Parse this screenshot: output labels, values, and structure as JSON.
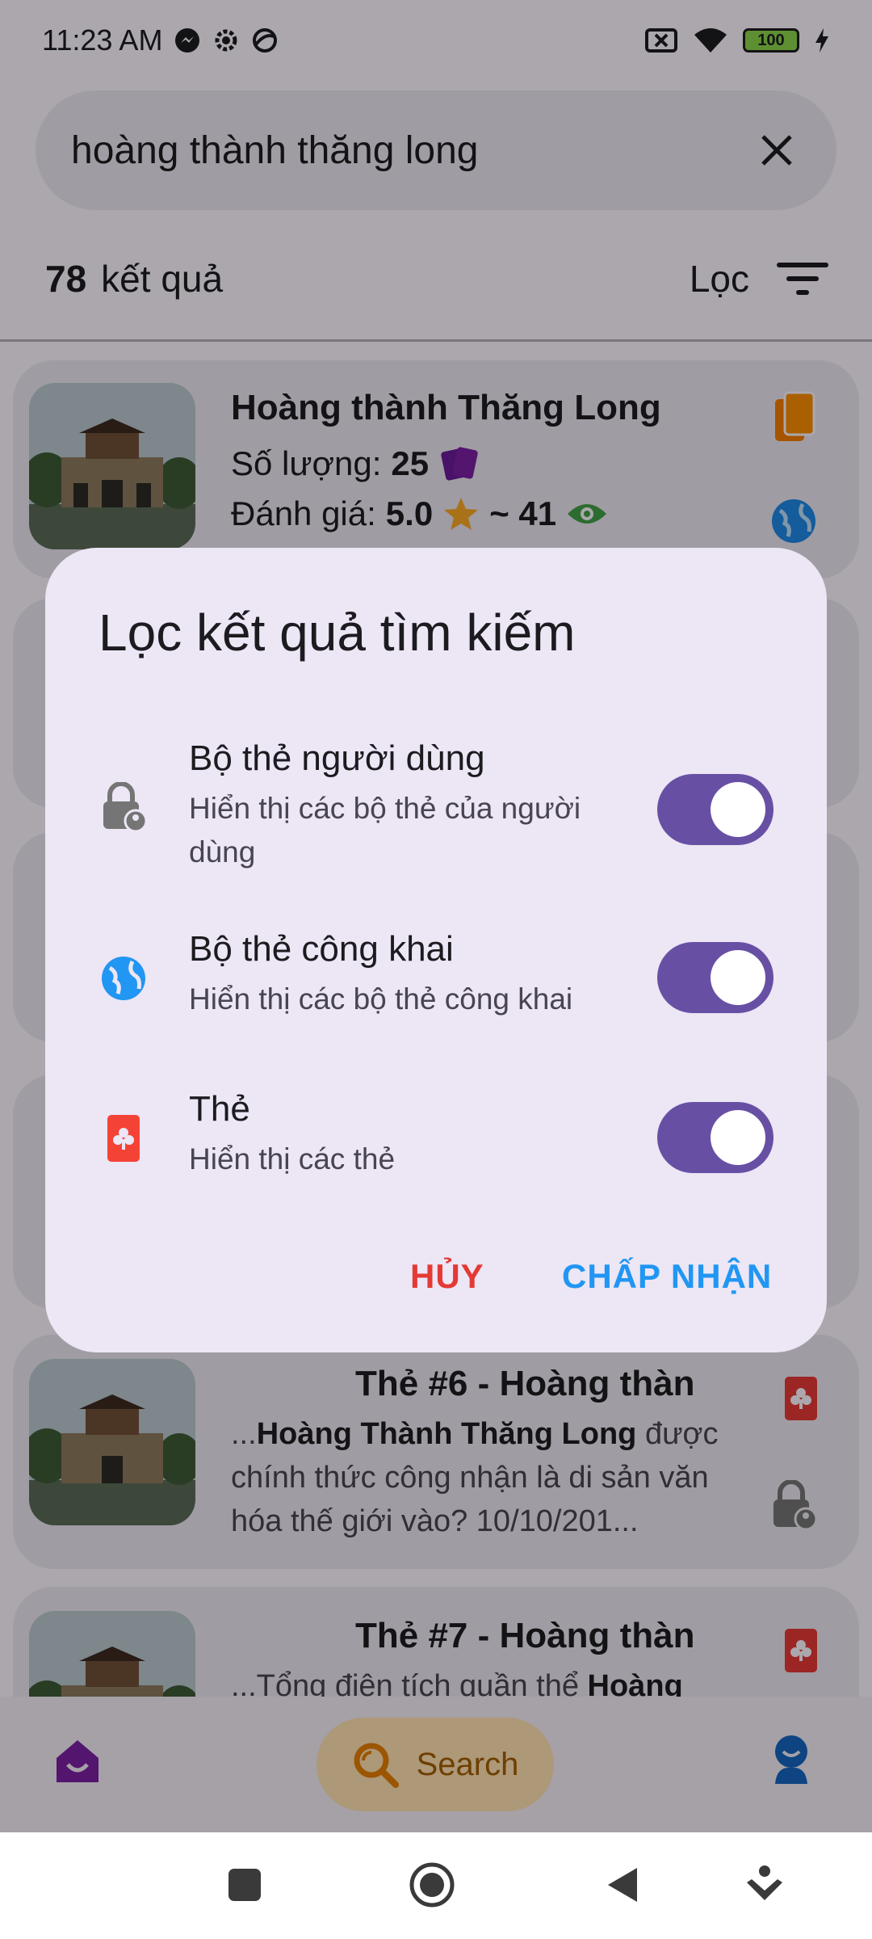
{
  "status_bar": {
    "time": "11:23 AM",
    "battery": "100"
  },
  "search": {
    "query": "hoàng thành thăng long"
  },
  "results": {
    "count": "78",
    "label": "kết quả",
    "filter_label": "Lọc"
  },
  "cards": [
    {
      "title": "Hoàng thành Thăng Long",
      "qty_label": "Số lượng:",
      "qty_value": "25",
      "rating_label": "Đánh giá:",
      "rating_value": "5.0",
      "views": "~ 41"
    },
    {
      "title": "Thẻ #6 - Hoàng thàn",
      "snippet_prefix": "...",
      "snippet_bold": "Hoàng Thành Thăng Long",
      "snippet_rest": " được chính thức công nhận là di sản văn hóa thế giới vào? 10/10/201..."
    },
    {
      "title": "Thẻ #7 - Hoàng thàn",
      "snippet_prefix": "...Tổng điện tích quần thể ",
      "snippet_bold": "Hoàng",
      "snippet_rest": ""
    }
  ],
  "bottom_nav": {
    "search_label": "Search"
  },
  "dialog": {
    "title": "Lọc kết quả tìm kiếm",
    "options": [
      {
        "title": "Bộ thẻ người dùng",
        "subtitle": "Hiển thị các bộ thẻ của người dùng",
        "enabled": true,
        "icon": "lock-person-icon"
      },
      {
        "title": "Bộ thẻ công khai",
        "subtitle": "Hiển thị các bộ thẻ công khai",
        "enabled": true,
        "icon": "globe-icon"
      },
      {
        "title": "Thẻ",
        "subtitle": "Hiển thị các thẻ",
        "enabled": true,
        "icon": "club-card-icon"
      }
    ],
    "cancel_label": "HỦY",
    "accept_label": "CHẤP NHẬN"
  },
  "colors": {
    "switch_on": "#6750a4",
    "cancel": "#e53935",
    "accept": "#2196f3",
    "nav_search_bg": "#ffe0b2"
  }
}
